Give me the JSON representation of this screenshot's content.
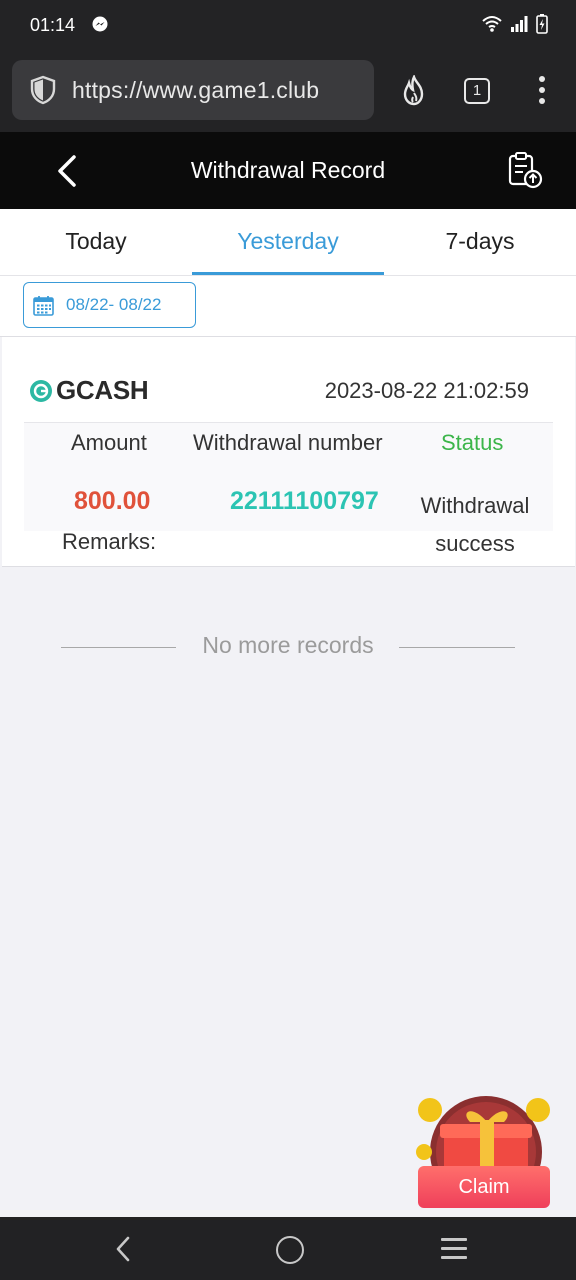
{
  "status_bar": {
    "time": "01:14"
  },
  "browser": {
    "url": "https://www.game1.club",
    "tab_count": "1"
  },
  "header": {
    "title": "Withdrawal Record"
  },
  "tabs": [
    {
      "label": "Today",
      "active": false
    },
    {
      "label": "Yesterday",
      "active": true
    },
    {
      "label": "7-days",
      "active": false
    }
  ],
  "date_filter": {
    "range": "08/22- 08/22"
  },
  "record": {
    "method": "GCASH",
    "time": "2023-08-22 21:02:59",
    "amount_label": "Amount",
    "number_label": "Withdrawal number",
    "status_label": "Status",
    "amount": "800.00",
    "withdrawal_number": "22111100797",
    "status_line1": "Withdrawal",
    "status_line2": "success",
    "remarks_label": "Remarks:"
  },
  "footer": {
    "no_more": "No more records"
  },
  "claim": {
    "label": "Claim"
  },
  "colors": {
    "accent": "#3a9bd8",
    "amount": "#e0523a",
    "number": "#2cc4b3",
    "status_label": "#3cb54a",
    "claim": "#ef3f5b"
  }
}
